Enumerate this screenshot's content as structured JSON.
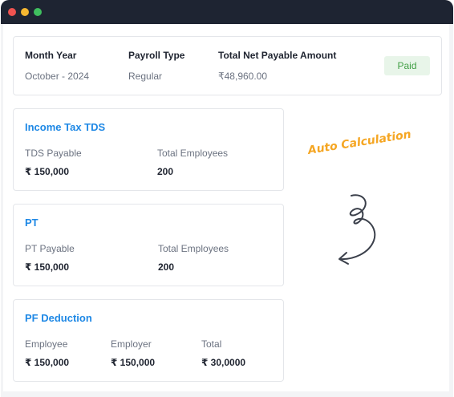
{
  "summary": {
    "month_year_label": "Month Year",
    "month_year_value": "October - 2024",
    "payroll_type_label": "Payroll Type",
    "payroll_type_value": "Regular",
    "net_payable_label": "Total Net Payable Amount",
    "net_payable_value": "₹48,960.00",
    "status": "Paid"
  },
  "income_tax": {
    "title": "Income Tax TDS",
    "tds_payable_label": "TDS Payable",
    "tds_payable_value": "₹ 150,000",
    "employees_label": "Total Employees",
    "employees_value": "200"
  },
  "pt": {
    "title": "PT",
    "pt_payable_label": "PT Payable",
    "pt_payable_value": "₹ 150,000",
    "employees_label": "Total Employees",
    "employees_value": "200"
  },
  "pf": {
    "title": "PF Deduction",
    "employee_label": "Employee",
    "employee_value": "₹ 150,000",
    "employer_label": "Employer",
    "employer_value": "₹ 150,000",
    "total_label": "Total",
    "total_value": "₹ 30,0000"
  },
  "annotation": {
    "text": "Auto Calculation"
  },
  "colors": {
    "accent": "#1e88e5",
    "paid_bg": "#e8f5e9",
    "paid_text": "#43a047",
    "annotation": "#f5a623",
    "titlebar": "#1e2432"
  }
}
